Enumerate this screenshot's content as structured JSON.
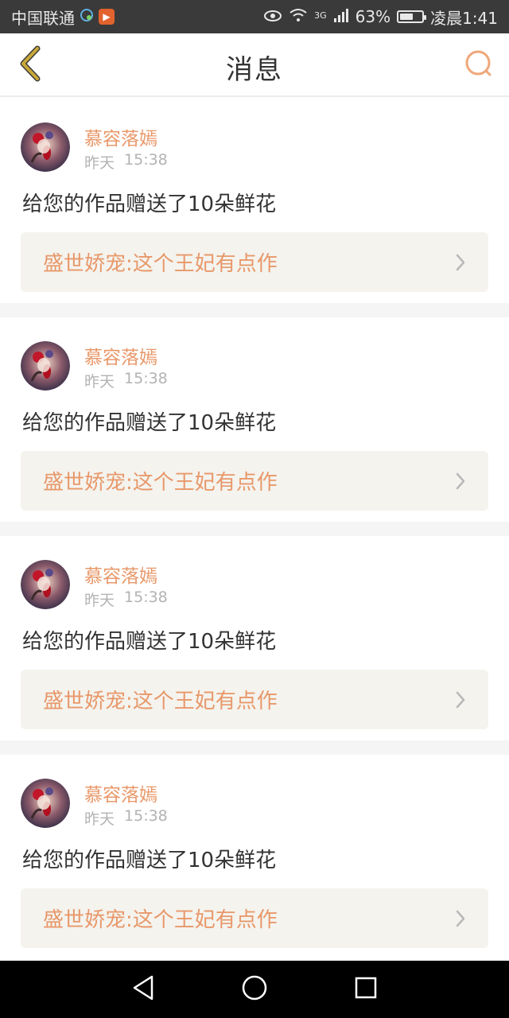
{
  "status_bar": {
    "carrier": "中国联通",
    "network": "3G",
    "battery_percent": "63%",
    "time": "凌晨1:41",
    "battery_level": 0.63
  },
  "header": {
    "title": "消息",
    "back_icon": "chevron-left-icon",
    "search_icon": "search-icon"
  },
  "messages": [
    {
      "sender": "慕容落嫣",
      "day": "昨天",
      "time": "15:38",
      "text": "给您的作品赠送了10朵鲜花",
      "work_title": "盛世娇宠:这个王妃有点作"
    },
    {
      "sender": "慕容落嫣",
      "day": "昨天",
      "time": "15:38",
      "text": "给您的作品赠送了10朵鲜花",
      "work_title": "盛世娇宠:这个王妃有点作"
    },
    {
      "sender": "慕容落嫣",
      "day": "昨天",
      "time": "15:38",
      "text": "给您的作品赠送了10朵鲜花",
      "work_title": "盛世娇宠:这个王妃有点作"
    },
    {
      "sender": "慕容落嫣",
      "day": "昨天",
      "time": "15:38",
      "text": "给您的作品赠送了10朵鲜花",
      "work_title": "盛世娇宠:这个王妃有点作"
    }
  ],
  "colors": {
    "accent": "#e8986a",
    "back_icon": "#c9a83a",
    "search_icon": "#f0a77a",
    "link_bg": "#f4f3ee"
  },
  "nav_bar": {
    "icons": [
      "back-triangle-icon",
      "home-circle-icon",
      "recents-square-icon"
    ]
  }
}
